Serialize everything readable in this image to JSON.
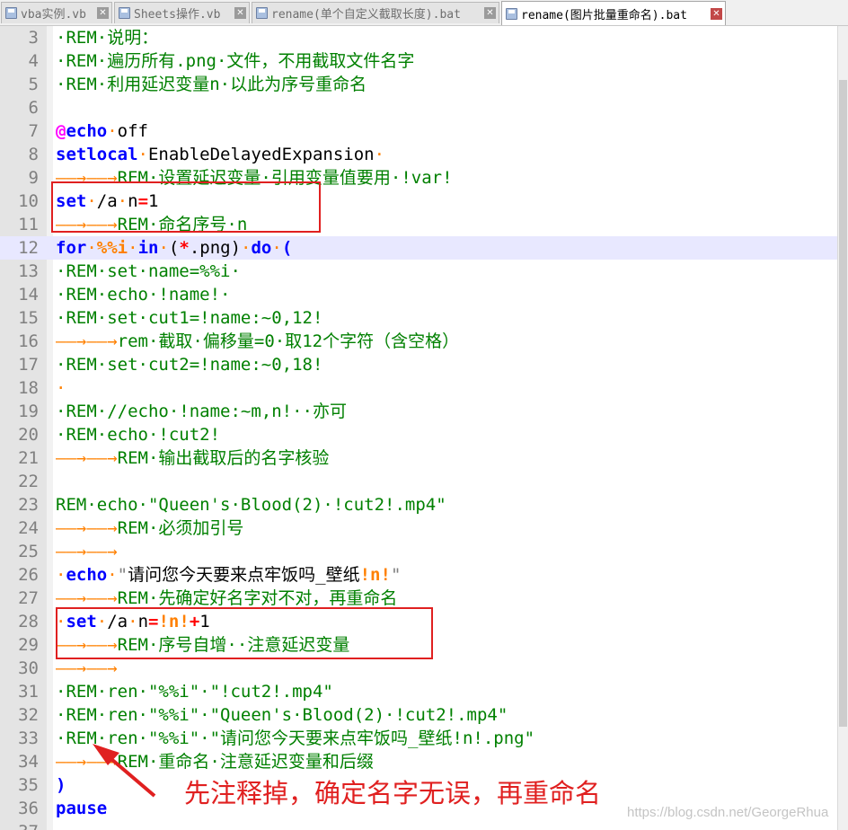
{
  "tabs": [
    {
      "label": "vba实例.vb",
      "close": "✕",
      "active": false
    },
    {
      "label": "Sheets操作.vb",
      "close": "✕",
      "active": false
    },
    {
      "label": "rename(单个自定义截取长度).bat",
      "close": "✕",
      "active": false
    },
    {
      "label": "rename(图片批量重命名).bat",
      "close": "✕",
      "active": true
    }
  ],
  "annotation": {
    "note": "先注释掉，确定名字无误，再重命名",
    "color": "#e02020"
  },
  "watermark": "https://blog.csdn.net/GeorgeRhua",
  "lines": [
    {
      "n": "3",
      "t": [
        [
          "c-rem",
          "·REM·"
        ],
        [
          "c-rem cjk",
          "说明："
        ]
      ]
    },
    {
      "n": "4",
      "t": [
        [
          "c-rem",
          "·REM·"
        ],
        [
          "c-rem cjk",
          "遍历所有"
        ],
        [
          "c-rem",
          ".png·"
        ],
        [
          "c-rem cjk",
          "文件，不用截取文件名字"
        ]
      ]
    },
    {
      "n": "5",
      "t": [
        [
          "c-rem",
          "·REM·"
        ],
        [
          "c-rem cjk",
          "利用延迟变量"
        ],
        [
          "c-rem",
          "n·"
        ],
        [
          "c-rem cjk",
          "以此为序号重命名"
        ]
      ]
    },
    {
      "n": "6",
      "t": []
    },
    {
      "n": "7",
      "t": [
        [
          "c-at",
          "@"
        ],
        [
          "c-kw",
          "echo"
        ],
        [
          "c-ws",
          "·"
        ],
        [
          "",
          "off"
        ]
      ]
    },
    {
      "n": "8",
      "t": [
        [
          "c-kw",
          "setlocal"
        ],
        [
          "c-ws",
          "·"
        ],
        [
          "",
          "EnableDelayedExpansion"
        ],
        [
          "c-ws",
          "·"
        ]
      ]
    },
    {
      "n": "9",
      "t": [
        [
          "c-ws",
          "——→——→"
        ],
        [
          "c-rem",
          "REM·"
        ],
        [
          "c-rem cjk",
          "设置延迟变量"
        ],
        [
          "c-rem",
          "·"
        ],
        [
          "c-rem cjk",
          "引用变量值要用"
        ],
        [
          "c-rem",
          "·!var!"
        ]
      ]
    },
    {
      "n": "10",
      "t": [
        [
          "c-kw",
          "set"
        ],
        [
          "c-ws",
          "·"
        ],
        [
          "",
          "/a"
        ],
        [
          "c-ws",
          "·"
        ],
        [
          "",
          "n"
        ],
        [
          "c-red",
          "="
        ],
        [
          "",
          "1"
        ]
      ]
    },
    {
      "n": "11",
      "t": [
        [
          "c-ws",
          "——→——→"
        ],
        [
          "c-rem",
          "REM·"
        ],
        [
          "c-rem cjk",
          "命名序号"
        ],
        [
          "c-rem",
          "·n"
        ]
      ]
    },
    {
      "n": "12",
      "current": true,
      "t": [
        [
          "c-kw",
          "for"
        ],
        [
          "c-ws",
          "·"
        ],
        [
          "c-orange",
          "%%i"
        ],
        [
          "c-ws",
          "·"
        ],
        [
          "c-kw",
          "in"
        ],
        [
          "c-ws",
          "·"
        ],
        [
          "",
          "("
        ],
        [
          "c-red",
          "*"
        ],
        [
          "",
          ".png)"
        ],
        [
          "c-ws",
          "·"
        ],
        [
          "c-kw",
          "do"
        ],
        [
          "c-ws",
          "·"
        ],
        [
          "c-kw",
          "("
        ]
      ]
    },
    {
      "n": "13",
      "t": [
        [
          "c-rem",
          "·REM·set·name=%%i·"
        ]
      ]
    },
    {
      "n": "14",
      "t": [
        [
          "c-rem",
          "·REM·echo·!name!·"
        ]
      ]
    },
    {
      "n": "15",
      "t": [
        [
          "c-rem",
          "·REM·set·cut1=!name:~0,12!"
        ]
      ]
    },
    {
      "n": "16",
      "t": [
        [
          "c-ws",
          "——→——→"
        ],
        [
          "c-rem",
          "rem·"
        ],
        [
          "c-rem cjk",
          "截取"
        ],
        [
          "c-rem",
          "·"
        ],
        [
          "c-rem cjk",
          "偏移量"
        ],
        [
          "c-rem",
          "=0·"
        ],
        [
          "c-rem cjk",
          "取"
        ],
        [
          "c-rem",
          "12"
        ],
        [
          "c-rem cjk",
          "个字符（含空格）"
        ]
      ]
    },
    {
      "n": "17",
      "t": [
        [
          "c-rem",
          "·REM·set·cut2=!name:~0,18!"
        ]
      ]
    },
    {
      "n": "18",
      "t": [
        [
          "c-ws",
          "·"
        ]
      ]
    },
    {
      "n": "19",
      "t": [
        [
          "c-rem",
          "·REM·//echo·!name:~m,n!··"
        ],
        [
          "c-rem cjk",
          "亦可"
        ]
      ]
    },
    {
      "n": "20",
      "t": [
        [
          "c-rem",
          "·REM·echo·!cut2!"
        ]
      ]
    },
    {
      "n": "21",
      "t": [
        [
          "c-ws",
          "——→——→"
        ],
        [
          "c-rem",
          "REM·"
        ],
        [
          "c-rem cjk",
          "输出截取后的名字核验"
        ]
      ]
    },
    {
      "n": "22",
      "t": []
    },
    {
      "n": "23",
      "t": [
        [
          "c-rem",
          "REM·echo·\"Queen's·Blood(2)·!cut2!.mp4\""
        ]
      ]
    },
    {
      "n": "24",
      "t": [
        [
          "c-ws",
          "——→——→"
        ],
        [
          "c-rem",
          "REM·"
        ],
        [
          "c-rem cjk",
          "必须加引号"
        ]
      ]
    },
    {
      "n": "25",
      "t": [
        [
          "c-ws",
          "——→——→"
        ]
      ]
    },
    {
      "n": "26",
      "t": [
        [
          "c-ws",
          "·"
        ],
        [
          "c-kw",
          "echo"
        ],
        [
          "c-ws",
          "·"
        ],
        [
          "c-str",
          "\""
        ],
        [
          "cjk",
          "请问您今天要来点牢饭吗"
        ],
        [
          "",
          "_"
        ],
        [
          "cjk",
          "壁纸"
        ],
        [
          "c-orange",
          "!n!"
        ],
        [
          "c-str",
          "\""
        ]
      ]
    },
    {
      "n": "27",
      "t": [
        [
          "c-ws",
          "——→——→"
        ],
        [
          "c-rem",
          "REM·"
        ],
        [
          "c-rem cjk",
          "先确定好名字对不对，再重命名"
        ]
      ]
    },
    {
      "n": "28",
      "t": [
        [
          "c-ws",
          "·"
        ],
        [
          "c-kw",
          "set"
        ],
        [
          "c-ws",
          "·"
        ],
        [
          "",
          "/a"
        ],
        [
          "c-ws",
          "·"
        ],
        [
          "",
          "n"
        ],
        [
          "c-red",
          "="
        ],
        [
          "c-orange",
          "!n!"
        ],
        [
          "c-red",
          "+"
        ],
        [
          "",
          "1"
        ]
      ]
    },
    {
      "n": "29",
      "t": [
        [
          "c-ws",
          "——→——→"
        ],
        [
          "c-rem",
          "REM·"
        ],
        [
          "c-rem cjk",
          "序号自增"
        ],
        [
          "c-rem",
          "··"
        ],
        [
          "c-rem cjk",
          "注意延迟变量"
        ]
      ]
    },
    {
      "n": "30",
      "t": [
        [
          "c-ws",
          "——→——→"
        ]
      ]
    },
    {
      "n": "31",
      "t": [
        [
          "c-rem",
          "·REM·ren·\"%%i\"·\"!cut2!.mp4\""
        ]
      ]
    },
    {
      "n": "32",
      "t": [
        [
          "c-rem",
          "·REM·ren·\"%%i\"·\"Queen's·Blood(2)·!cut2!.mp4\""
        ]
      ]
    },
    {
      "n": "33",
      "t": [
        [
          "c-rem",
          "·REM·ren·\"%%i\"·\""
        ],
        [
          "c-rem cjk",
          "请问您今天要来点牢饭吗"
        ],
        [
          "c-rem",
          "_"
        ],
        [
          "c-rem cjk",
          "壁纸"
        ],
        [
          "c-rem",
          "!n!.png\""
        ]
      ]
    },
    {
      "n": "34",
      "t": [
        [
          "c-ws",
          "——→——→"
        ],
        [
          "c-rem",
          "REM·"
        ],
        [
          "c-rem cjk",
          "重命名"
        ],
        [
          "c-rem",
          "·"
        ],
        [
          "c-rem cjk",
          "注意延迟变量和后缀"
        ]
      ]
    },
    {
      "n": "35",
      "t": [
        [
          "c-kw",
          ")"
        ]
      ]
    },
    {
      "n": "36",
      "t": [
        [
          "c-kw",
          "pause"
        ]
      ]
    },
    {
      "n": "37",
      "t": []
    }
  ]
}
